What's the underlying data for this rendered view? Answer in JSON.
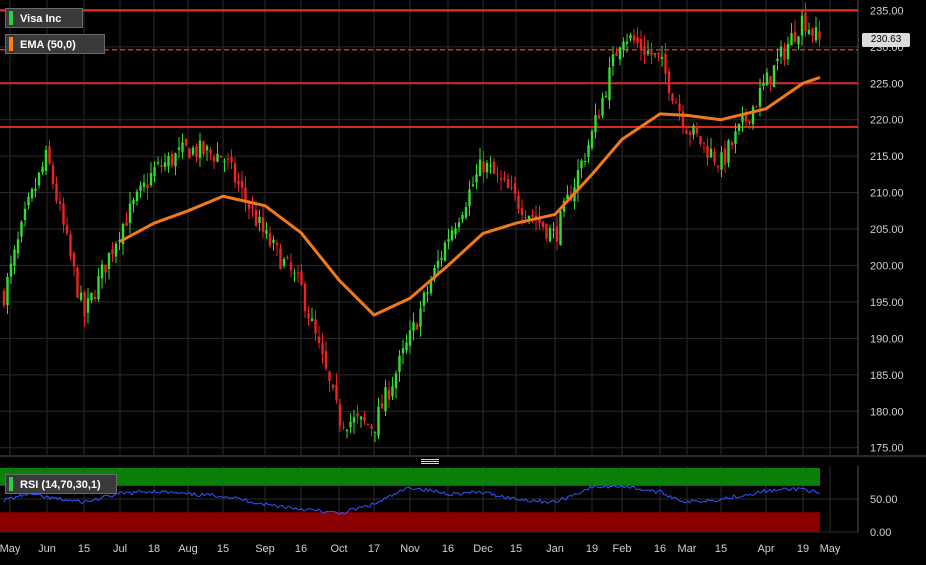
{
  "legends": {
    "price": {
      "label": "Visa Inc",
      "color": "#2ecc40"
    },
    "ema": {
      "label": "EMA (50,0)",
      "color": "#ff7f1a"
    },
    "rsi": {
      "label": "RSI (14,70,30,1)",
      "color": "#2ecc40"
    }
  },
  "last_price_label": "230.63",
  "colors": {
    "background": "#000000",
    "grid": "#2b2b2b",
    "up_candle": "#33dd33",
    "down_candle": "#ee2222",
    "ema_line": "#f07a1a",
    "level_line": "#dd2a1a",
    "rsi_line": "#3355ff",
    "rsi_overbought": "#0a7f0a",
    "rsi_oversold": "#8b0000",
    "axis_text": "#cfcfcf"
  },
  "chart_data": [
    {
      "type": "candlestick",
      "title": "Visa Inc",
      "ylim": [
        174,
        235.6
      ],
      "y_ticks": [
        "175.00",
        "180.00",
        "185.00",
        "190.00",
        "195.00",
        "200.00",
        "205.00",
        "210.00",
        "215.00",
        "220.00",
        "225.00",
        "230.00",
        "235.00"
      ],
      "x_labels": [
        "May",
        "Jun",
        "15",
        "Jul",
        "18",
        "Aug",
        "15",
        "Sep",
        "16",
        "Oct",
        "17",
        "Nov",
        "16",
        "Dec",
        "15",
        "Jan",
        "19",
        "Feb",
        "16",
        "Mar",
        "15",
        "Apr",
        "19",
        "May"
      ],
      "grid": true,
      "price_series": {
        "name": "Visa Inc",
        "dates": [
          "May 1",
          "May 15",
          "Jun 1",
          "Jun 15",
          "Jul 1",
          "Jul 18",
          "Aug 1",
          "Aug 15",
          "Sep 1",
          "Sep 16",
          "Oct 1",
          "Oct 17",
          "Nov 1",
          "Nov 16",
          "Dec 1",
          "Dec 15",
          "Jan 4",
          "Jan 19",
          "Feb 1",
          "Feb 16",
          "Mar 1",
          "Mar 15",
          "Apr 1",
          "Apr 19",
          "Apr 26"
        ],
        "close": [
          196,
          208,
          215,
          193,
          205,
          213,
          216,
          215,
          204,
          197,
          179,
          178,
          190,
          204,
          214,
          209,
          204,
          218,
          232,
          228,
          219,
          214,
          225,
          234,
          230.6
        ]
      },
      "ema_series": {
        "name": "EMA (50,0)",
        "dates": [
          "Jul 1",
          "Jul 18",
          "Aug 1",
          "Aug 15",
          "Sep 1",
          "Sep 16",
          "Oct 1",
          "Oct 17",
          "Nov 1",
          "Nov 16",
          "Dec 1",
          "Dec 15",
          "Jan 4",
          "Jan 19",
          "Feb 1",
          "Feb 16",
          "Mar 1",
          "Mar 15",
          "Apr 1",
          "Apr 19",
          "Apr 26"
        ],
        "values": [
          203.3,
          205.8,
          207.5,
          209.5,
          208.2,
          204.5,
          198,
          193.2,
          195.5,
          200,
          204.4,
          205.8,
          207,
          212.5,
          217.3,
          220.8,
          220.6,
          220,
          221.5,
          225,
          225.8
        ]
      },
      "horizontal_levels": [
        235.0,
        229.6,
        225.0,
        219.0
      ],
      "last_price": 230.63
    },
    {
      "type": "line",
      "title": "RSI (14,70,30,1)",
      "ylim": [
        0,
        100
      ],
      "y_ticks": [
        "50.00",
        "0.00"
      ],
      "overbought": 70,
      "oversold": 30,
      "series": [
        {
          "name": "RSI (14,70,30,1)",
          "values": [
            48,
            58,
            52,
            45,
            58,
            62,
            57,
            55,
            42,
            35,
            28,
            42,
            68,
            58,
            60,
            50,
            45,
            68,
            70,
            60,
            45,
            50,
            62,
            66,
            57
          ]
        }
      ]
    }
  ]
}
